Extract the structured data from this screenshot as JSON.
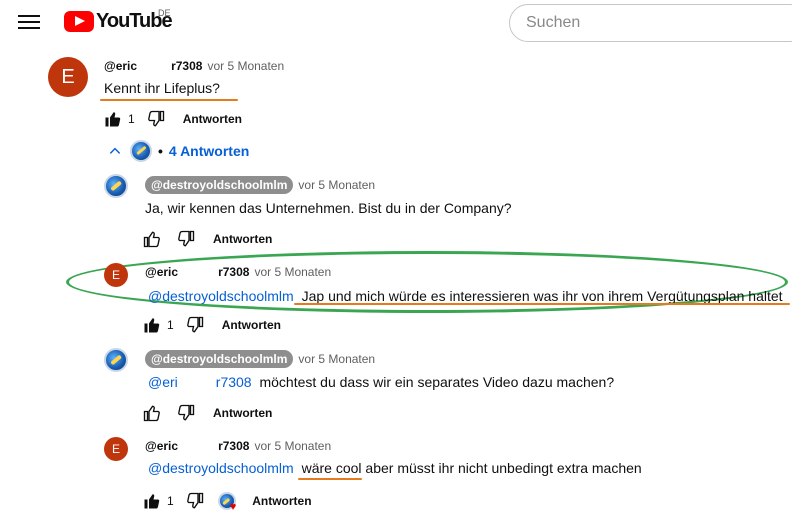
{
  "header": {
    "logo_text": "YouTube",
    "region": "DE",
    "search_placeholder": "Suchen"
  },
  "comments": [
    {
      "author": "@eric",
      "author_tail": "r7308",
      "time": "vor 5 Monaten",
      "text": "Kennt ihr Lifeplus?",
      "likes": "1",
      "reply_label": "Antworten",
      "avatar_letter": "E"
    }
  ],
  "replies_toggle": "4 Antworten",
  "replies": [
    {
      "author": "@destroyoldschoolmlm",
      "time": "vor 5 Monaten",
      "text": "Ja, wir kennen das Unternehmen. Bist du in der Company?",
      "reply_label": "Antworten"
    },
    {
      "author": "@eric",
      "author_tail": "r7308",
      "time": "vor 5 Monaten",
      "mention": "@destroyoldschoolmlm",
      "text": "Jap und mich würde es interessieren was ihr von ihrem Vergütungsplan haltet",
      "likes": "1",
      "reply_label": "Antworten",
      "avatar_letter": "E"
    },
    {
      "author": "@destroyoldschoolmlm",
      "time": "vor 5 Monaten",
      "mention": "@eri",
      "mention_tail": "r7308",
      "text": "möchtest du dass wir ein separates Video dazu machen?",
      "reply_label": "Antworten"
    },
    {
      "author": "@eric",
      "author_tail": "r7308",
      "time": "vor 5 Monaten",
      "mention": "@destroyoldschoolmlm",
      "text": "wäre cool aber müsst ihr nicht unbedingt extra machen",
      "likes": "1",
      "reply_label": "Antworten",
      "avatar_letter": "E"
    }
  ],
  "colors": {
    "avatar_e": "#bf360c",
    "link": "#065fd4",
    "annotation_orange": "#e87a1e",
    "annotation_green": "#3aa652"
  }
}
